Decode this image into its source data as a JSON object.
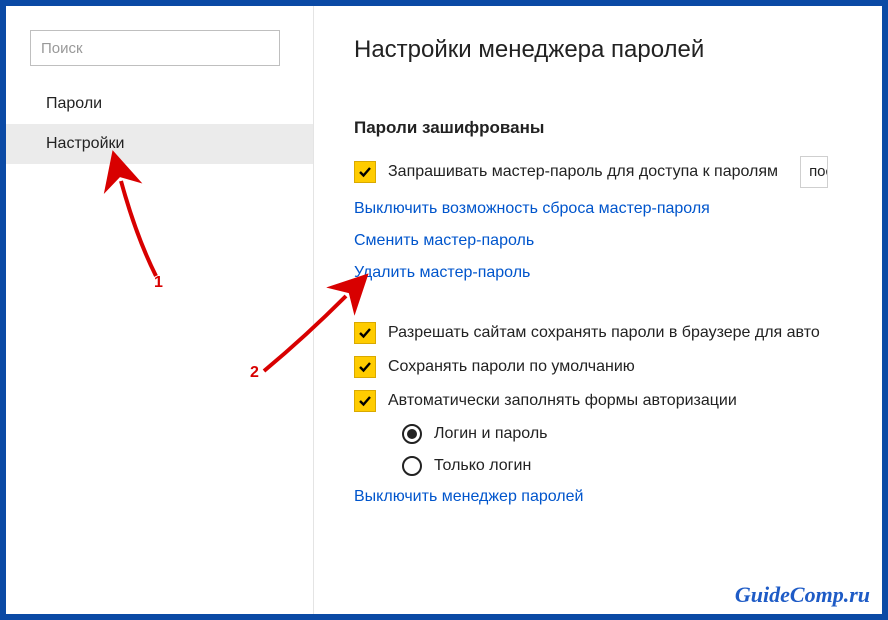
{
  "sidebar": {
    "search_placeholder": "Поиск",
    "items": [
      {
        "label": "Пароли",
        "active": false
      },
      {
        "label": "Настройки",
        "active": true
      }
    ]
  },
  "main": {
    "title": "Настройки менеджера паролей",
    "section_title": "Пароли зашифрованы",
    "master_checkbox_label": "Запрашивать мастер-пароль для доступа к паролям",
    "master_dropdown_value": "пос",
    "links": {
      "disable_reset": "Выключить возможность сброса мастер-пароля",
      "change_master": "Сменить мастер-пароль",
      "delete_master": "Удалить мастер-пароль",
      "disable_manager": "Выключить менеджер паролей"
    },
    "options": {
      "allow_save": "Разрешать сайтам сохранять пароли в браузере для авто",
      "save_default": "Сохранять пароли по умолчанию",
      "autofill": "Автоматически заполнять формы авторизации",
      "radio_login_password": "Логин и пароль",
      "radio_login_only": "Только логин"
    }
  },
  "annotations": {
    "num1": "1",
    "num2": "2"
  },
  "watermark": "GuideComp.ru"
}
